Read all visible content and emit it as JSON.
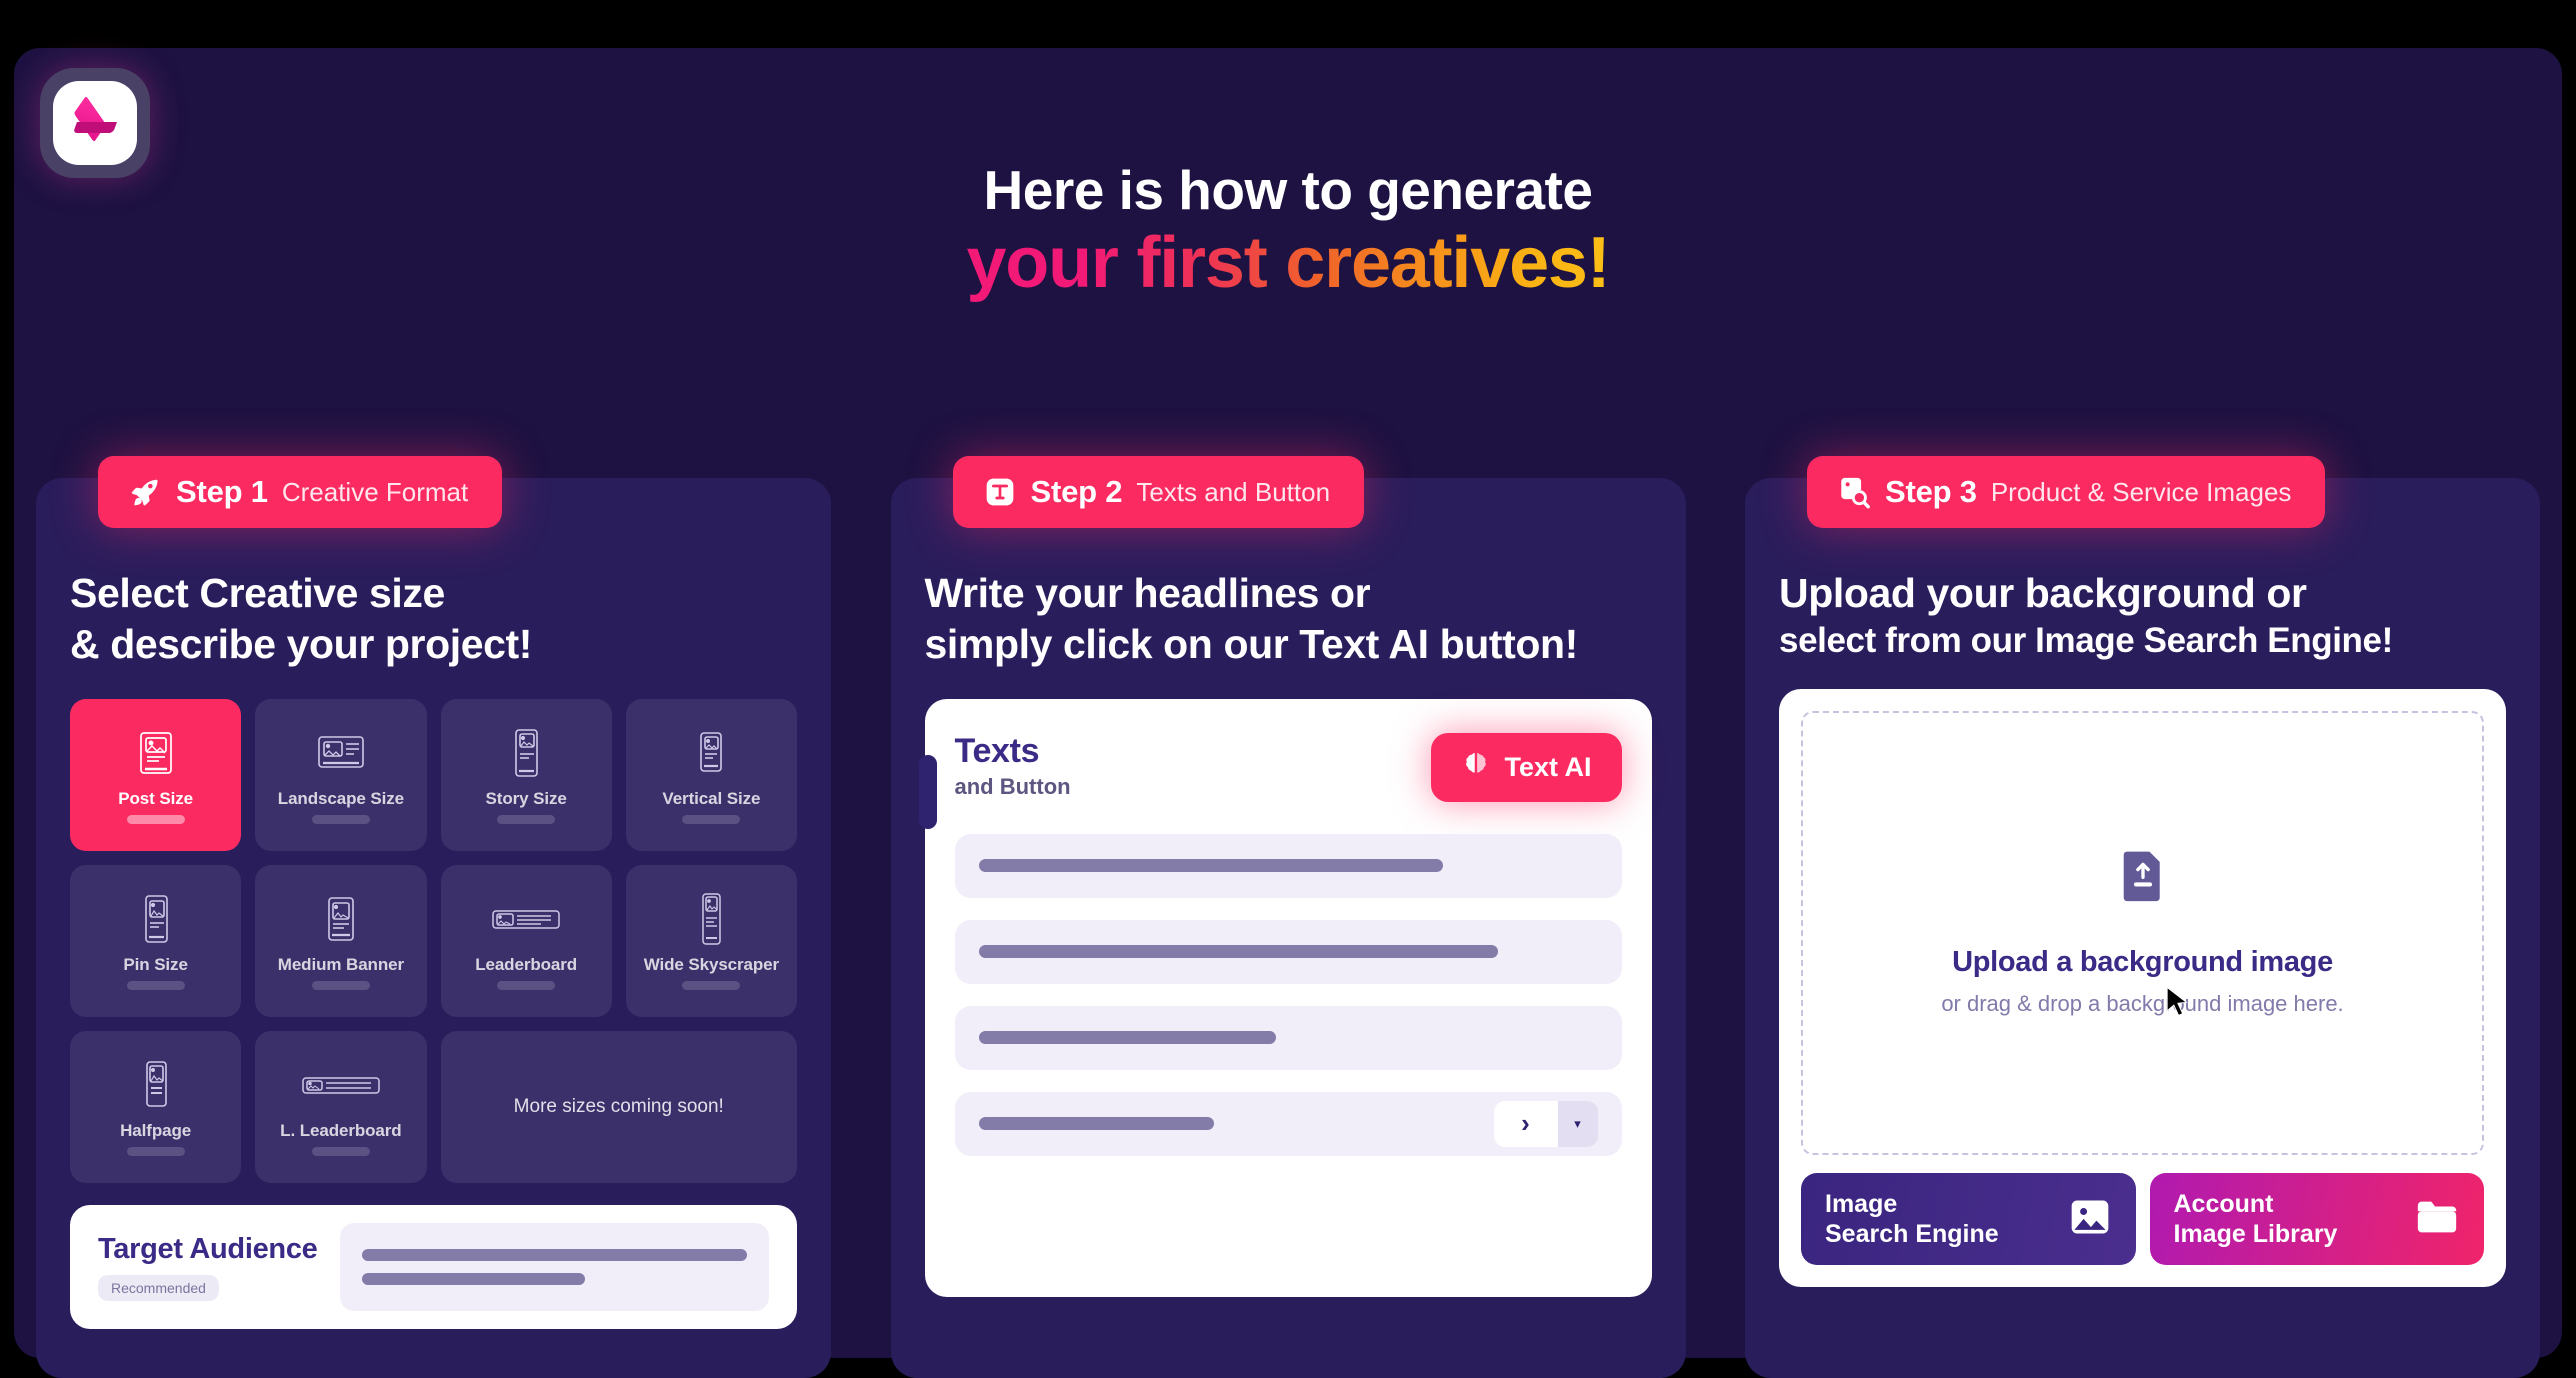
{
  "brand": {
    "logo_icon": "cube-logo-icon",
    "accent": "#fb2b62",
    "panel": "#2a1d5c",
    "bg": "#1d1242"
  },
  "headline": {
    "line1": "Here is how to generate",
    "line2": "your first creatives!"
  },
  "steps": [
    {
      "badge_icon": "rocket-icon",
      "badge_number": "Step 1",
      "badge_sub": "Creative Format",
      "title_line1": "Select Creative size",
      "title_line2": "& describe your project!",
      "sizes": [
        {
          "label": "Post Size",
          "icon": "post-size-icon",
          "active": true
        },
        {
          "label": "Landscape Size",
          "icon": "landscape-size-icon",
          "active": false
        },
        {
          "label": "Story Size",
          "icon": "story-size-icon",
          "active": false
        },
        {
          "label": "Vertical Size",
          "icon": "vertical-size-icon",
          "active": false
        },
        {
          "label": "Pin Size",
          "icon": "pin-size-icon",
          "active": false
        },
        {
          "label": "Medium Banner",
          "icon": "medium-banner-icon",
          "active": false
        },
        {
          "label": "Leaderboard",
          "icon": "leaderboard-icon",
          "active": false
        },
        {
          "label": "Wide Skyscraper",
          "icon": "wide-skyscraper-icon",
          "active": false
        },
        {
          "label": "Halfpage",
          "icon": "halfpage-icon",
          "active": false
        },
        {
          "label": "L. Leaderboard",
          "icon": "l-leaderboard-icon",
          "active": false
        }
      ],
      "coming_soon": "More sizes coming soon!",
      "target_audience": {
        "title": "Target Audience",
        "pill": "Recommended"
      }
    },
    {
      "badge_icon": "text-box-icon",
      "badge_number": "Step 2",
      "badge_sub": "Texts and Button",
      "title_line1": "Write your headlines or",
      "title_line2": "simply click on our Text AI button!",
      "panel": {
        "heading": "Texts",
        "subheading": "and Button",
        "ai_button": {
          "label": "Text AI",
          "icon": "brain-icon"
        },
        "rows": 4,
        "chevron_icon": "chevron-right-icon",
        "dropdown_icon": "caret-down-icon"
      }
    },
    {
      "badge_icon": "image-search-icon",
      "badge_number": "Step 3",
      "badge_sub": "Product & Service Images",
      "title_line1": "Upload your background or",
      "title_line2": "select from our Image Search Engine!",
      "dropzone": {
        "icon": "file-upload-icon",
        "title": "Upload a background image",
        "subtitle": "or drag & drop a background image here."
      },
      "buttons": [
        {
          "line1": "Image",
          "line2": "Search Engine",
          "icon": "picture-icon",
          "style": "search"
        },
        {
          "line1": "Account",
          "line2": "Image Library",
          "icon": "folder-icon",
          "style": "library"
        }
      ]
    }
  ],
  "cursor": {
    "icon": "mouse-pointer-icon"
  }
}
